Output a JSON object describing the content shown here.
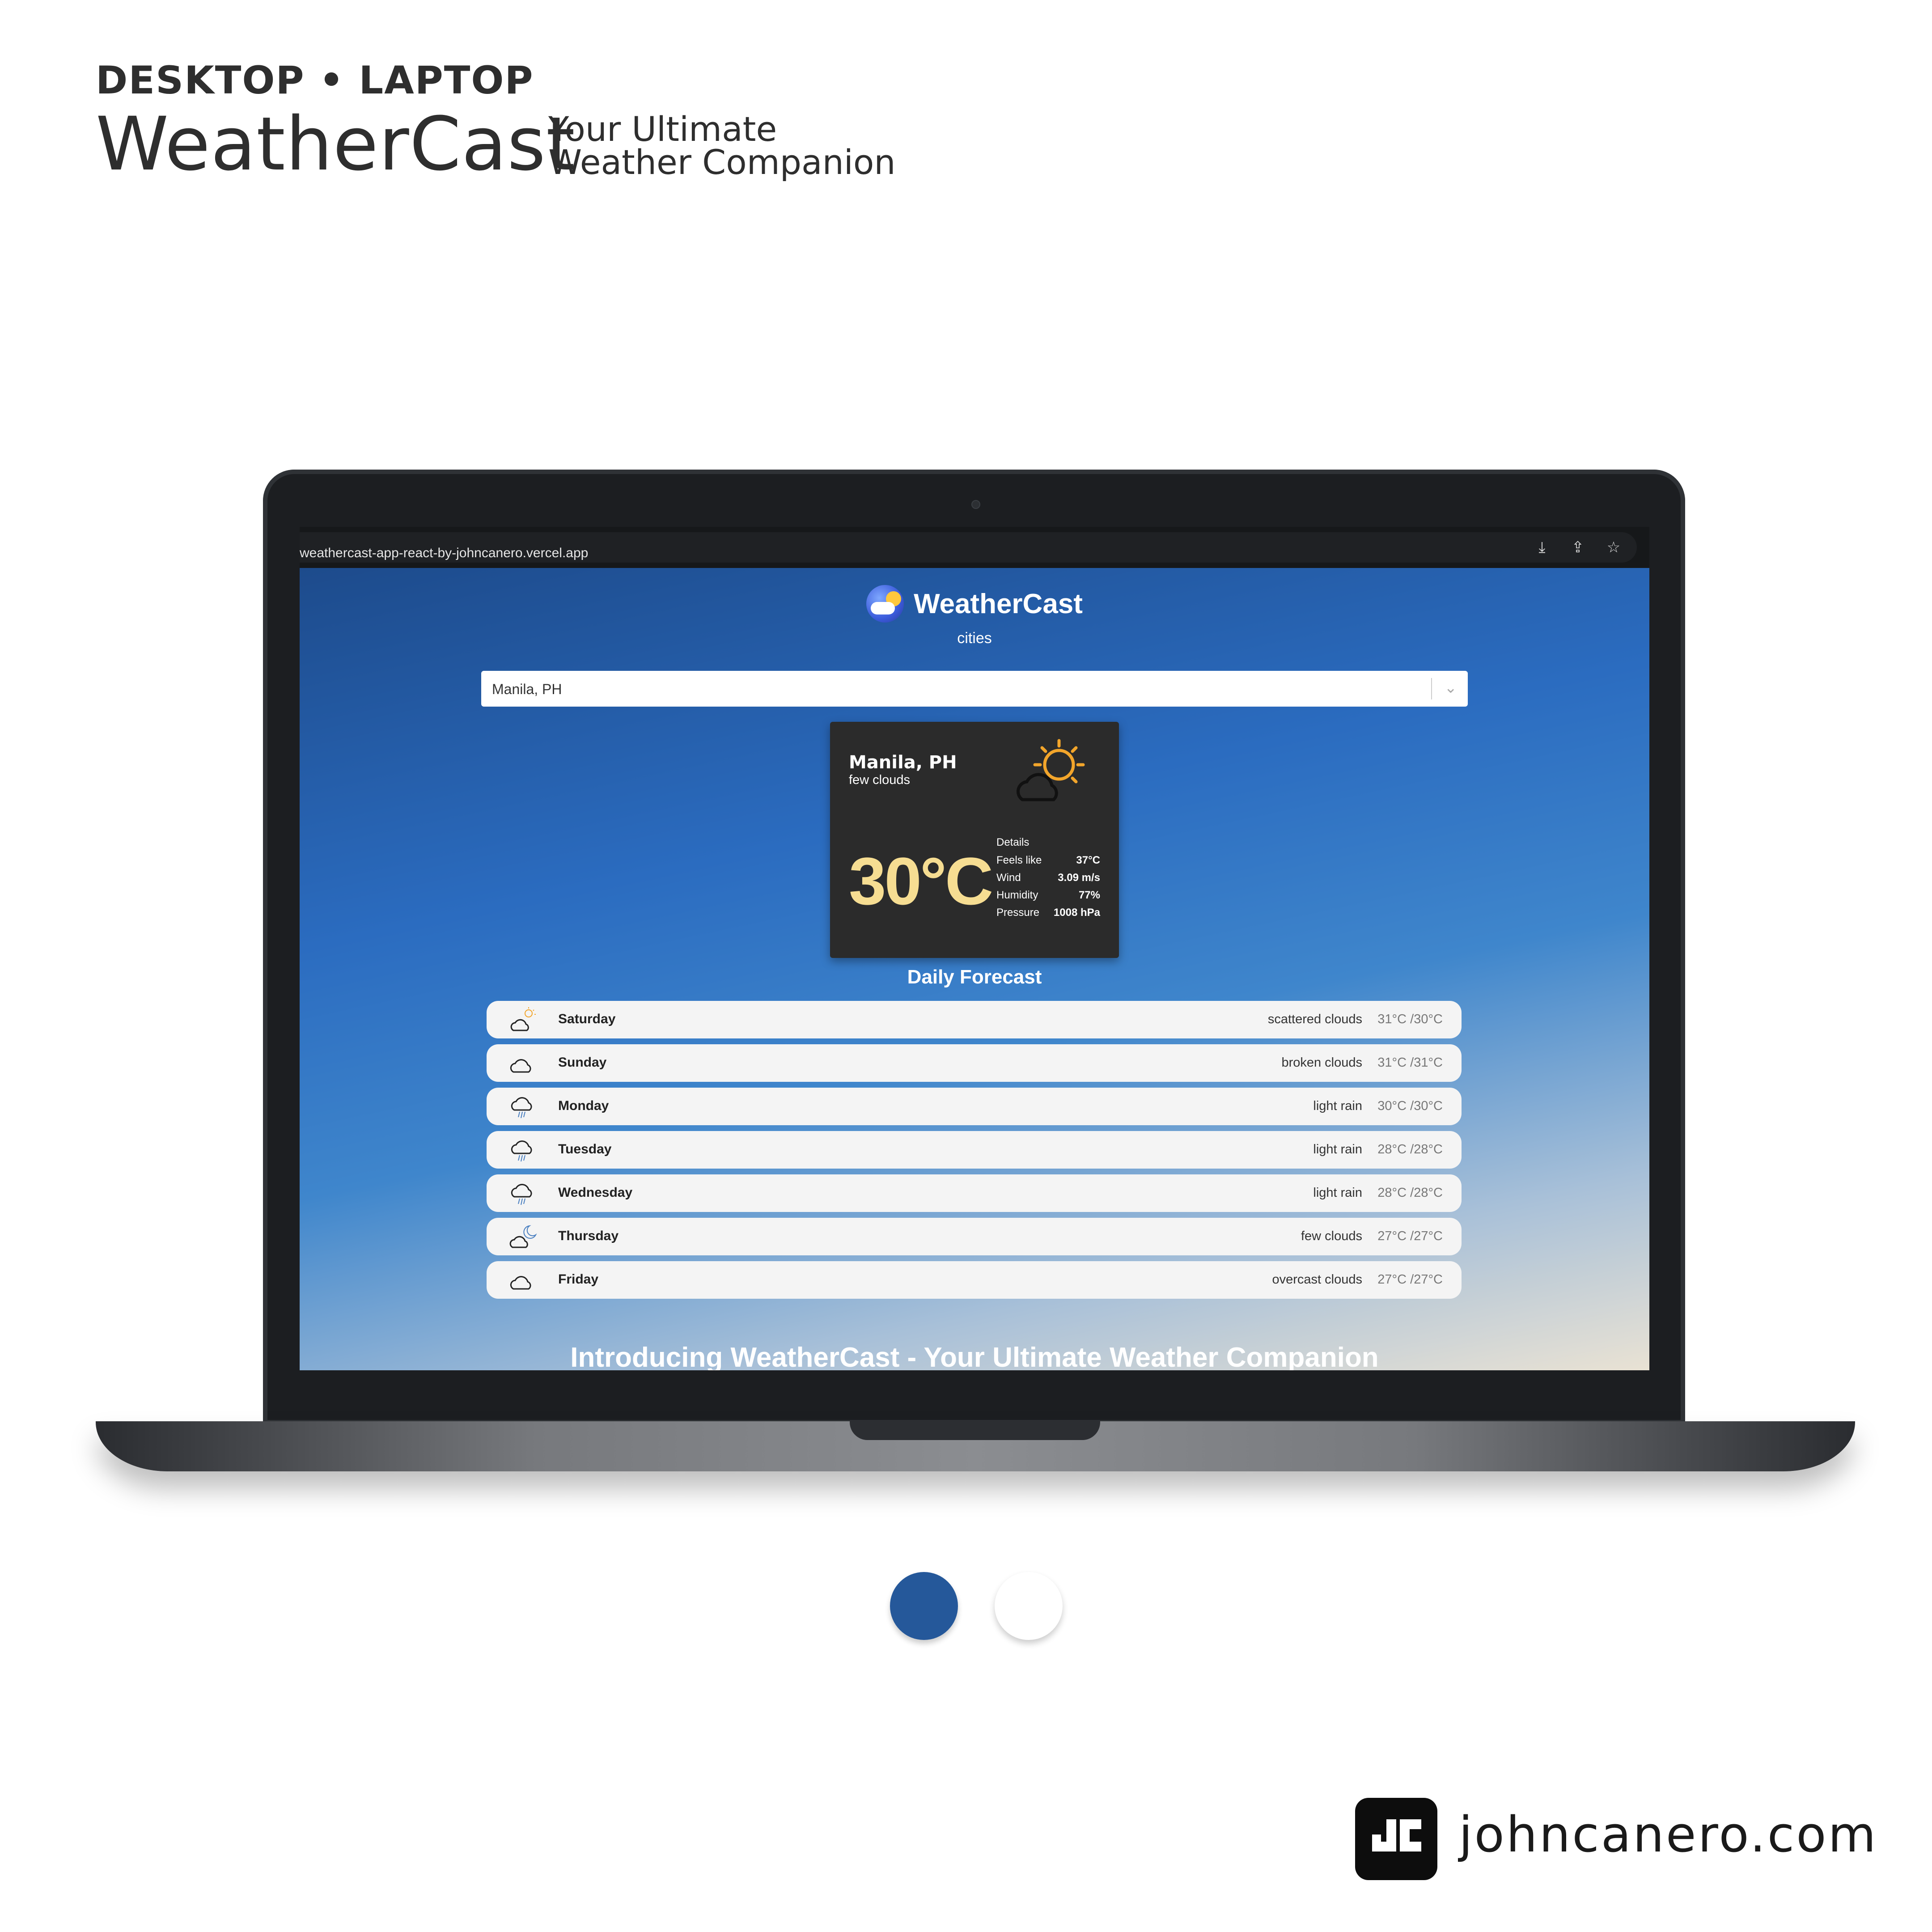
{
  "header": {
    "kicker": "DESKTOP • LAPTOP",
    "brand": "WeatherCast",
    "tagline_line1": "Your Ultimate",
    "tagline_line2": "Weather Companion"
  },
  "browser": {
    "url": "weathercast-app-react-by-johncanero.vercel.app",
    "icons": [
      "install-icon",
      "share-icon",
      "star-icon"
    ]
  },
  "app": {
    "title": "WeatherCast",
    "subtitle": "cities",
    "search": {
      "value": "Manila, PH",
      "placeholder": ""
    },
    "current": {
      "city": "Manila, PH",
      "description": "few clouds",
      "icon": "sun-cloud-icon",
      "temperature": "30°C",
      "details_heading": "Details",
      "details": [
        {
          "label": "Feels like",
          "value": "37°C"
        },
        {
          "label": "Wind",
          "value": "3.09 m/s"
        },
        {
          "label": "Humidity",
          "value": "77%"
        },
        {
          "label": "Pressure",
          "value": "1008 hPa"
        }
      ]
    },
    "forecast_title": "Daily Forecast",
    "forecast": [
      {
        "day": "Saturday",
        "description": "scattered clouds",
        "temps": "31°C /30°C",
        "icon": "sun-cloud-icon"
      },
      {
        "day": "Sunday",
        "description": "broken clouds",
        "temps": "31°C /31°C",
        "icon": "cloud-icon"
      },
      {
        "day": "Monday",
        "description": "light rain",
        "temps": "30°C /30°C",
        "icon": "rain-icon"
      },
      {
        "day": "Tuesday",
        "description": "light rain",
        "temps": "28°C /28°C",
        "icon": "rain-icon"
      },
      {
        "day": "Wednesday",
        "description": "light rain",
        "temps": "28°C /28°C",
        "icon": "rain-icon"
      },
      {
        "day": "Thursday",
        "description": "few clouds",
        "temps": "27°C /27°C",
        "icon": "moon-cloud-icon"
      },
      {
        "day": "Friday",
        "description": "overcast clouds",
        "temps": "27°C /27°C",
        "icon": "cloud-icon"
      }
    ],
    "intro_heading": "Introducing WeatherCast - Your Ultimate Weather Companion"
  },
  "palette": {
    "primary": "#25589a",
    "secondary": "#ffffff",
    "temperature_accent": "#f6dd92"
  },
  "footer": {
    "site": "johncanero.com",
    "logo": "jc-logo-icon"
  }
}
